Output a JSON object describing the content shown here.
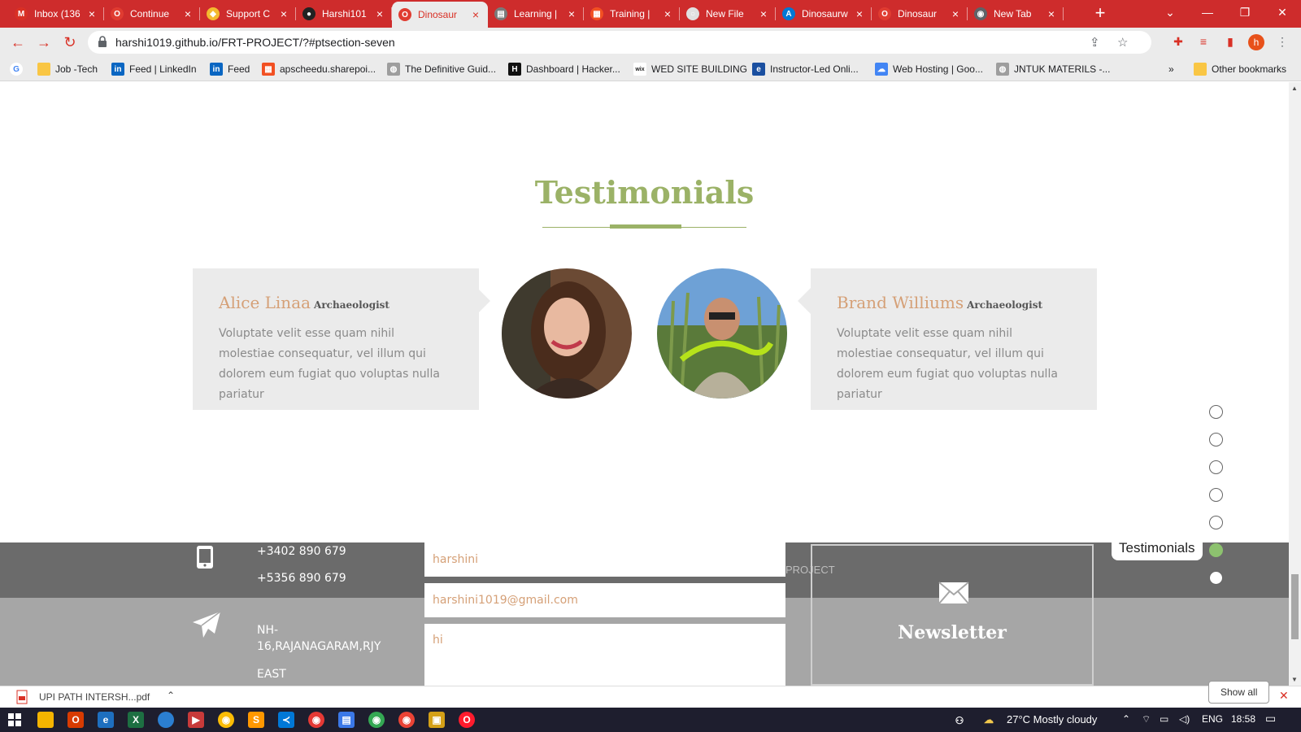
{
  "browser": {
    "tabs": [
      {
        "title": "Inbox (136",
        "icon": "gmail-icon",
        "color": "#d93025",
        "glyph": "M",
        "active": false
      },
      {
        "title": "Continue",
        "icon": "opera-icon",
        "color": "#e03c31",
        "glyph": "O",
        "active": false
      },
      {
        "title": "Support C",
        "icon": "binance-icon",
        "color": "#f3ba2f",
        "glyph": "◆",
        "active": false
      },
      {
        "title": "Harshi101",
        "icon": "github-icon",
        "color": "#222222",
        "glyph": "●",
        "active": false
      },
      {
        "title": "Dinosaur",
        "icon": "opera-icon",
        "color": "#e03c31",
        "glyph": "O",
        "active": true
      },
      {
        "title": "Learning |",
        "icon": "learning-icon",
        "color": "#7a7a7a",
        "glyph": "▤",
        "active": false
      },
      {
        "title": "Training |",
        "icon": "microsoft-icon",
        "color": "#f25022",
        "glyph": "▦",
        "active": false
      },
      {
        "title": "New File",
        "icon": "file-icon",
        "color": "#e0e0e0",
        "glyph": "○",
        "active": false
      },
      {
        "title": "Dinosaurw",
        "icon": "azure-icon",
        "color": "#0078d4",
        "glyph": "A",
        "active": false
      },
      {
        "title": "Dinosaur",
        "icon": "opera-icon",
        "color": "#e03c31",
        "glyph": "O",
        "active": false
      },
      {
        "title": "New Tab",
        "icon": "chrome-icon",
        "color": "#5f6368",
        "glyph": "◉",
        "active": false
      }
    ],
    "url": "harshi1019.github.io/FRT-PROJECT/?#ptsection-seven",
    "profile_initial": "h",
    "bookmarks": [
      {
        "label": "Job -Tech",
        "icon": "folder-icon",
        "color": "#f9c644",
        "glyph": ""
      },
      {
        "label": "Feed | LinkedIn",
        "icon": "linkedin-icon",
        "color": "#0a66c2",
        "glyph": "in"
      },
      {
        "label": "Feed",
        "icon": "linkedin-icon",
        "color": "#0a66c2",
        "glyph": "in"
      },
      {
        "label": "apscheedu.sharepoi...",
        "icon": "microsoft-icon",
        "color": "#f25022",
        "glyph": "▦"
      },
      {
        "label": "The Definitive Guid...",
        "icon": "globe-icon",
        "color": "#9e9e9e",
        "glyph": "◍"
      },
      {
        "label": "Dashboard | Hacker...",
        "icon": "hackerrank-icon",
        "color": "#111111",
        "glyph": "H"
      },
      {
        "label": "WED SITE BUILDING",
        "icon": "wix-icon",
        "color": "#ffffff",
        "glyph": "wix"
      },
      {
        "label": "Instructor-Led Onli...",
        "icon": "edureka-icon",
        "color": "#1a4fa0",
        "glyph": "e"
      },
      {
        "label": "Web Hosting | Goo...",
        "icon": "google-cloud-icon",
        "color": "#4285f4",
        "glyph": "☁"
      },
      {
        "label": "JNTUK MATERILS -...",
        "icon": "globe-icon",
        "color": "#9e9e9e",
        "glyph": "◍"
      }
    ],
    "more_bookmarks": "»",
    "other_bookmarks": "Other bookmarks"
  },
  "testimonials": {
    "title": "Testimonials",
    "items": [
      {
        "name": "Alice Linaa",
        "role": "Archaeologist",
        "text": "Voluptate velit esse quam nihil molestiae consequatur, vel illum qui dolorem eum fugiat quo voluptas nulla pariatur"
      },
      {
        "name": "Brand Williums",
        "role": "Archaeologist",
        "text": "Voluptate velit esse quam nihil molestiae consequatur, vel illum qui dolorem eum fugiat quo voluptas nulla pariatur"
      }
    ]
  },
  "footer": {
    "phone_1": "+3402 890 679",
    "phone_2": "+5356 890 679",
    "address_1": "NH-",
    "address_2": "16,RAJANAGARAM,RJY",
    "address_3": "EAST",
    "name_value": "harshini",
    "email_value": "harshini1019@gmail.com",
    "message_value": "hi",
    "project_label": "PROJECT",
    "newsletter_label": "Newsletter"
  },
  "page_nav": {
    "dot_count": 7,
    "active_index": 5,
    "active_label": "Testimonials",
    "colors": {
      "active": "#8dc26f",
      "inactive": "#ffffff"
    }
  },
  "download": {
    "filename": "UPI PATH INTERSH...pdf",
    "show_all": "Show all"
  },
  "taskbar": {
    "weather": "27°C  Mostly cloudy",
    "language": "ENG",
    "time": "18:58"
  },
  "colors": {
    "accent": "#9bb267",
    "name": "#d5a077",
    "card_bg": "#ebebeb",
    "footer_dark": "#6b6b6b",
    "footer_light": "#a6a6a6",
    "tabstrip": "#ce2c2c"
  }
}
